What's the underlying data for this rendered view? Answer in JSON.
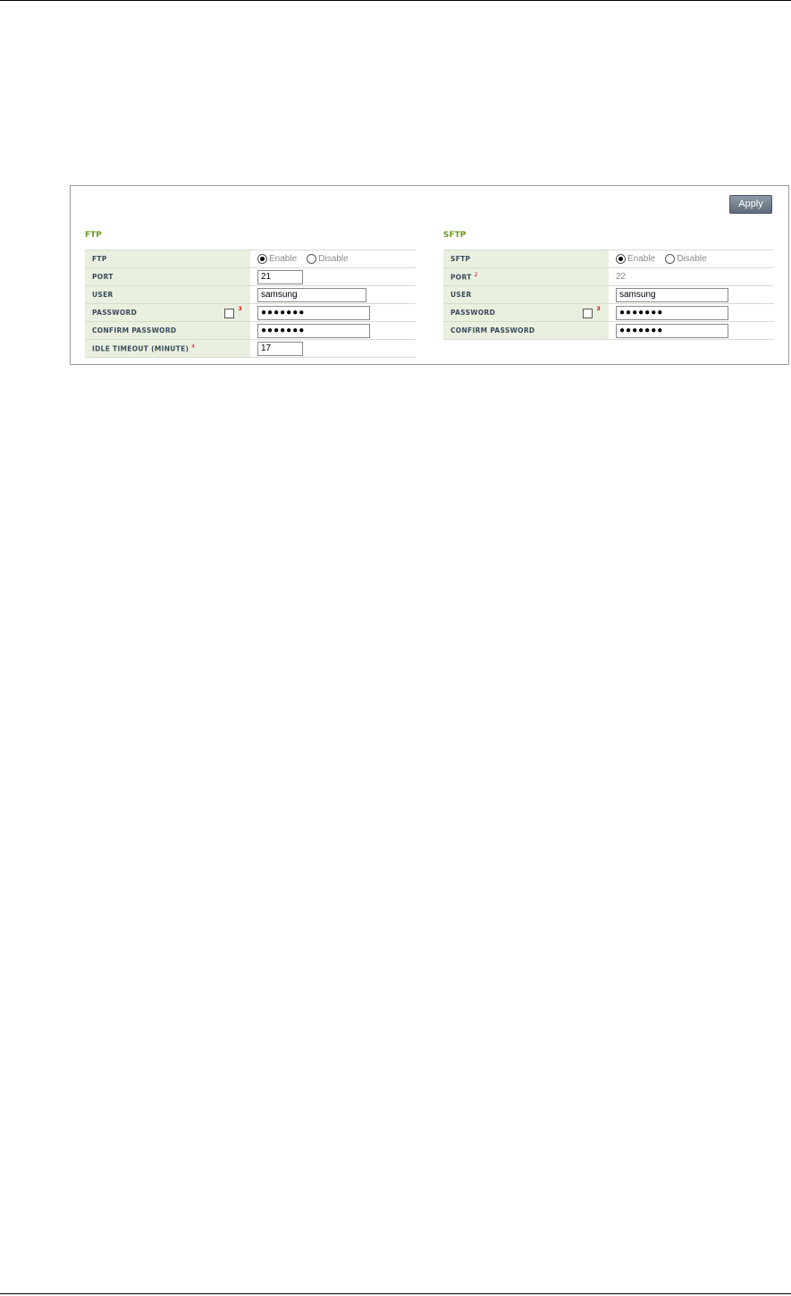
{
  "toolbar": {
    "apply_label": "Apply"
  },
  "ftp": {
    "title": "FTP",
    "rows": {
      "ftp_label": "FTP",
      "enable_label": "Enable",
      "disable_label": "Disable",
      "port_label": "PORT",
      "port_value": "21",
      "user_label": "USER",
      "user_value": "samsung",
      "password_label": "PASSWORD",
      "password_note": "3",
      "password_value": "●●●●●●●",
      "confirm_label": "CONFIRM PASSWORD",
      "confirm_value": "●●●●●●●",
      "idle_label": "IDLE TIMEOUT (MINUTE)",
      "idle_note": "4",
      "idle_value": "17"
    }
  },
  "sftp": {
    "title": "SFTP",
    "rows": {
      "sftp_label": "SFTP",
      "enable_label": "Enable",
      "disable_label": "Disable",
      "port_label": "PORT",
      "port_note": "2",
      "port_value": "22",
      "user_label": "USER",
      "user_value": "samsung",
      "password_label": "PASSWORD",
      "password_note": "3",
      "password_value": "●●●●●●●",
      "confirm_label": "CONFIRM PASSWORD",
      "confirm_value": "●●●●●●●"
    }
  }
}
